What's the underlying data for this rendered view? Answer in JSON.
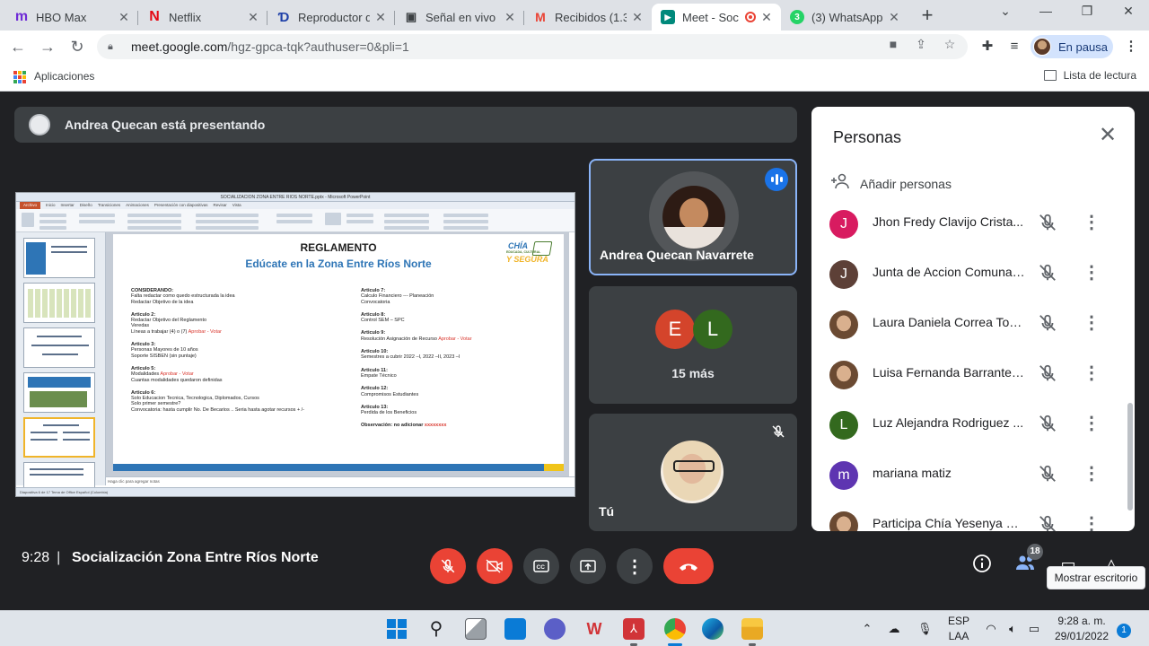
{
  "browser": {
    "tabs": [
      {
        "label": "HBO Max",
        "favicon": "hbo-icon",
        "color": "#6f2bd6"
      },
      {
        "label": "Netflix",
        "favicon": "netflix-icon",
        "color": "#e50914"
      },
      {
        "label": "Reproductor de",
        "favicon": "disney-icon",
        "color": "#1d3fa8"
      },
      {
        "label": "Señal en vivo |",
        "favicon": "tv-icon",
        "color": "#3c4043"
      },
      {
        "label": "Recibidos (1.36",
        "favicon": "gmail-icon",
        "color": "#ea4335"
      },
      {
        "label": "Meet - Soc",
        "favicon": "meet-icon",
        "color": "#00897b"
      },
      {
        "label": "(3) WhatsApp",
        "favicon": "whatsapp-icon",
        "color": "#25d366",
        "badge": "3"
      }
    ],
    "url_host": "meet.google.com",
    "url_path": "/hgz-gpca-tqk?authuser=0&pli=1",
    "profile_label": "En pausa",
    "bookmarks_label": "Aplicaciones",
    "reading_list_label": "Lista de lectura"
  },
  "meet": {
    "presenting_text": "Andrea Quecan está presentando",
    "slide": {
      "title": "REGLAMENTO",
      "subtitle": "Edúcate en la Zona Entre Ríos Norte",
      "logo_line1": "CHÍA",
      "logo_line2": "EDUCADA, CULTURAL",
      "logo_line3": "Y SEGURA",
      "window_title": "SOCIALIZACION ZONA ENTRE RIOS NORTE.pptx - Microsoft PowerPoint",
      "ribbon_tabs": [
        "Inicio",
        "Insertar",
        "Diseño",
        "Transiciones",
        "Animaciones",
        "Presentación con diapositivas",
        "Revisar",
        "Vista"
      ],
      "file_tab": "Archivo",
      "notes_placeholder": "Haga clic para agregar notas",
      "status_text": "Diapositiva 6 de 17   Tema de Office   Español (Colombia)",
      "left_col": [
        {
          "h": "CONSIDERANDO:",
          "lines": [
            "Falta redactar como quedo estructurada la idea",
            "Redactar Objetivo de la idea"
          ]
        },
        {
          "h": "Articulo 2:",
          "lines": [
            "Redactar Objetivo del Reglamento",
            "Veredas",
            "Líneas a trabajar (4) o (7)"
          ],
          "red": " Aprobar - Votar"
        },
        {
          "h": "Articulo 3:",
          "lines": [
            "Personas Mayores de 10 años",
            "Soporte SISBEN (sin puntaje)"
          ]
        },
        {
          "h": "Articulo 5:",
          "lines": [
            "Modalidades"
          ],
          "red_inline": " Aprobar - Votar",
          "extra": [
            "Cuantas modalidades quedaron definidas"
          ]
        },
        {
          "h": "Articulo 6:",
          "lines": [
            "Solo Educacion Tecnica, Tecnologica, Diplomados, Cursos",
            "Solo primer semestre?",
            "Convocatoria: hasta cumplir No. De Becarios .. Seria hasta agotar recursos + /-"
          ]
        }
      ],
      "right_col": [
        {
          "h": "Articulo 7:",
          "lines": [
            "Calculo Financiero  ---  Planeación",
            "Convocatoria"
          ]
        },
        {
          "h": "Articulo 8:",
          "lines": [
            "Control SEM – SPC"
          ]
        },
        {
          "h": "Articulo 9:",
          "lines": [
            "Resolución Asignación de Recurso"
          ],
          "red_inline": " Aprobar - Votar"
        },
        {
          "h": "Articulo 10:",
          "lines": [
            "Semestres a cubrir 2022 –I, 2022 –II, 2023 –I"
          ]
        },
        {
          "h": "Articulo 11:",
          "lines": [
            "Empate Técnico"
          ]
        },
        {
          "h": "Articulo 12:",
          "lines": [
            "Compromisos Estudiantes"
          ]
        },
        {
          "h": "Articulo 13:",
          "lines": [
            "Perdida de los Beneficios"
          ]
        },
        {
          "h": "Observación: no adicionar",
          "red_inline": " xxxxxxxx",
          "lines": []
        }
      ]
    },
    "tiles": {
      "presenter_name": "Andrea Quecan Navarrete",
      "more_initial_1": "E",
      "more_initial_2": "L",
      "more_label": "15 más",
      "self_name": "Tú"
    },
    "people_panel": {
      "title": "Personas",
      "add_label": "Añadir personas",
      "people": [
        {
          "name": "Jhon Fredy Clavijo Crista...",
          "initial": "J",
          "color": "#d81b60"
        },
        {
          "name": "Junta de Accion Comunal...",
          "initial": "J",
          "color": "#5d4037"
        },
        {
          "name": "Laura Daniela Correa Torr...",
          "initial": "",
          "color": "photo"
        },
        {
          "name": "Luisa Fernanda Barrantes ...",
          "initial": "",
          "color": "photo"
        },
        {
          "name": "Luz Alejandra Rodriguez ...",
          "initial": "L",
          "color": "#33691e"
        },
        {
          "name": "mariana matiz",
          "initial": "m",
          "color": "#5e35b1"
        },
        {
          "name": "Participa Chía Yesenya M...",
          "initial": "",
          "color": "photo"
        }
      ]
    },
    "bottom": {
      "time": "9:28",
      "meeting_name": "Socialización Zona Entre Ríos Norte",
      "participants_count": "18",
      "tooltip": "Mostrar escritorio"
    }
  },
  "taskbar": {
    "lang_line1": "ESP",
    "lang_line2": "LAA",
    "time": "9:28 a. m.",
    "date": "29/01/2022",
    "notifications": "1"
  }
}
